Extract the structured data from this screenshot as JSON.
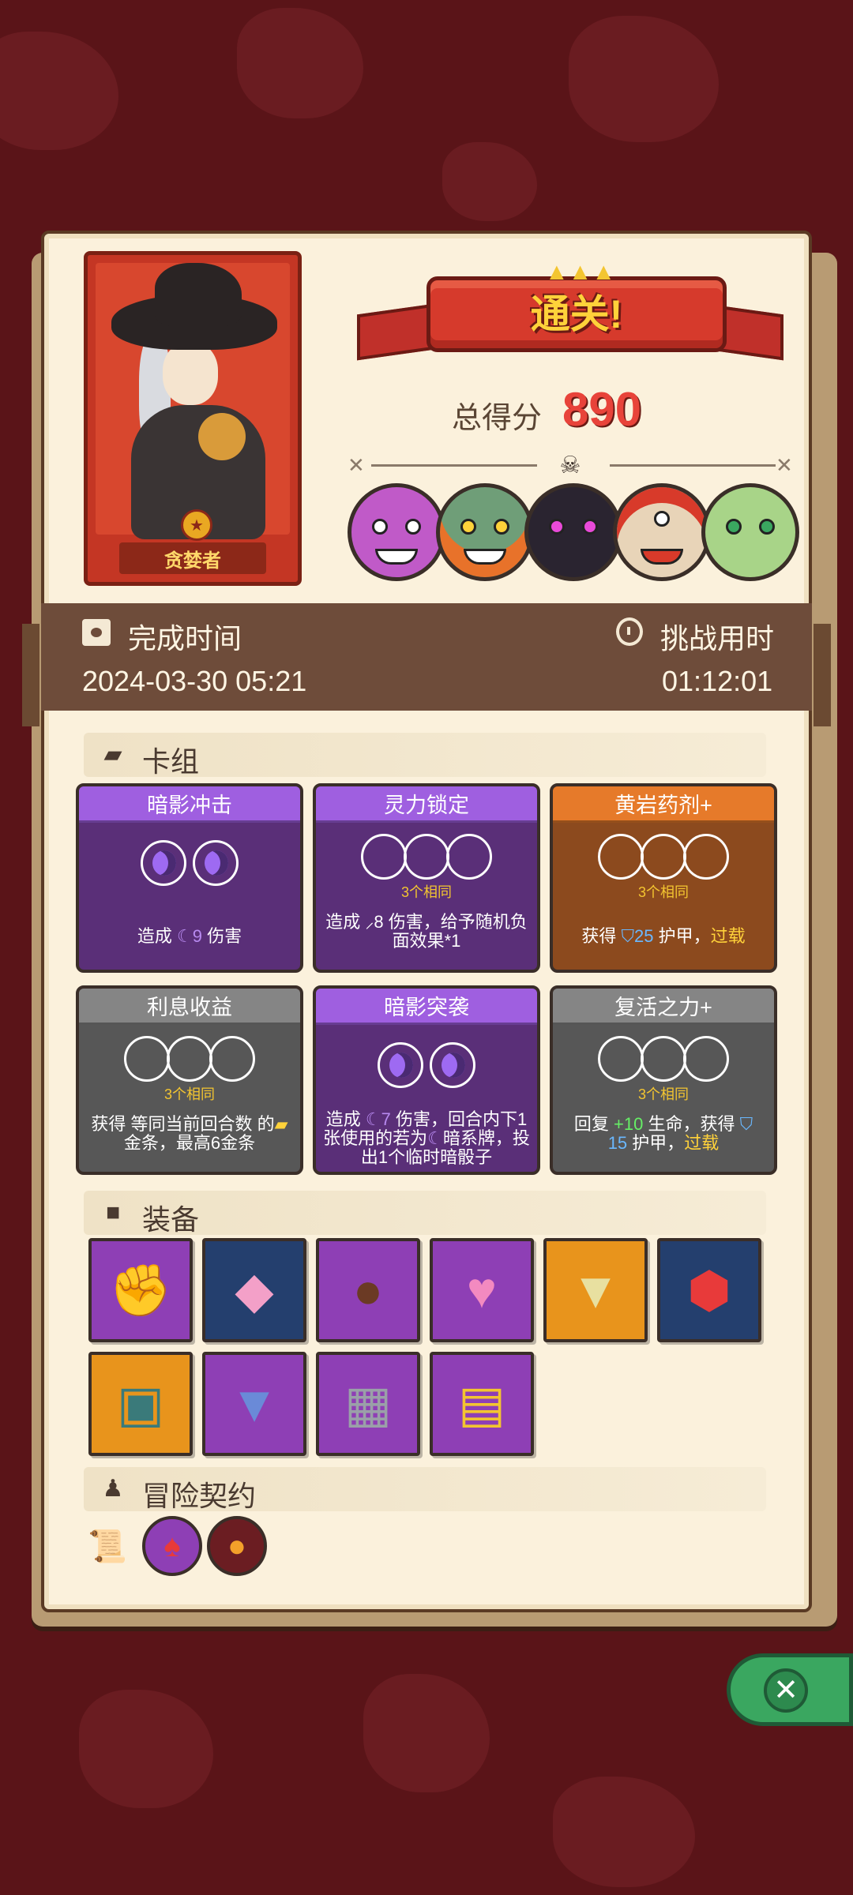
{
  "result": {
    "banner": "通关!",
    "score_label": "总得分",
    "score": "890"
  },
  "character": {
    "name": "贪婪者"
  },
  "stats": {
    "finish_time_label": "完成时间",
    "finish_time": "2024-03-30 05:21",
    "challenge_time_label": "挑战用时",
    "challenge_time": "01:12:01"
  },
  "deck": {
    "title": "卡组",
    "cards": [
      {
        "name": "暗影冲击",
        "color": "purple",
        "sub": "",
        "desc_parts": [
          "造成 ",
          "9",
          " 伤害"
        ]
      },
      {
        "name": "灵力锁定",
        "color": "purple",
        "sub": "3个相同",
        "desc_parts": [
          "造成 ",
          "8",
          " 伤害，给予随机负面效果*1"
        ]
      },
      {
        "name": "黄岩药剂+",
        "color": "orange",
        "sub": "3个相同",
        "desc_parts": [
          "获得 ",
          "25",
          " 护甲，",
          "过载"
        ]
      },
      {
        "name": "利息收益",
        "color": "gray",
        "sub": "3个相同",
        "desc_parts": [
          "获得 等同当前回合数 的",
          "金条，最高6金条"
        ]
      },
      {
        "name": "暗影突袭",
        "color": "purple",
        "sub": "",
        "desc_parts": [
          "造成 ",
          "7",
          " 伤害，回合内下1张使用的若为",
          "暗系牌，投出1个临时暗骰子"
        ]
      },
      {
        "name": "复活之力+",
        "color": "gray",
        "sub": "3个相同",
        "desc_parts": [
          "回复 ",
          "+10",
          " 生命，获得 ",
          "15",
          " 护甲，",
          "过载"
        ]
      }
    ]
  },
  "equipment": {
    "title": "装备",
    "items": [
      {
        "icon": "flame-gauntlet-icon",
        "color": "purple"
      },
      {
        "icon": "d20-die-icon",
        "color": "blue"
      },
      {
        "icon": "button-icon",
        "color": "purple"
      },
      {
        "icon": "heart-amulet-icon",
        "color": "purple"
      },
      {
        "icon": "golden-chalice-icon",
        "color": "orange"
      },
      {
        "icon": "red-gem-icon",
        "color": "blue"
      },
      {
        "icon": "spiked-helmet-icon",
        "color": "orange"
      },
      {
        "icon": "blue-tunic-icon",
        "color": "purple"
      },
      {
        "icon": "metal-cube-icon",
        "color": "purple"
      },
      {
        "icon": "treasure-chest-icon",
        "color": "purple"
      }
    ]
  },
  "contract": {
    "title": "冒险契约",
    "items": [
      "scroll-icon",
      "demon-contract-icon",
      "food-contract-icon"
    ]
  }
}
